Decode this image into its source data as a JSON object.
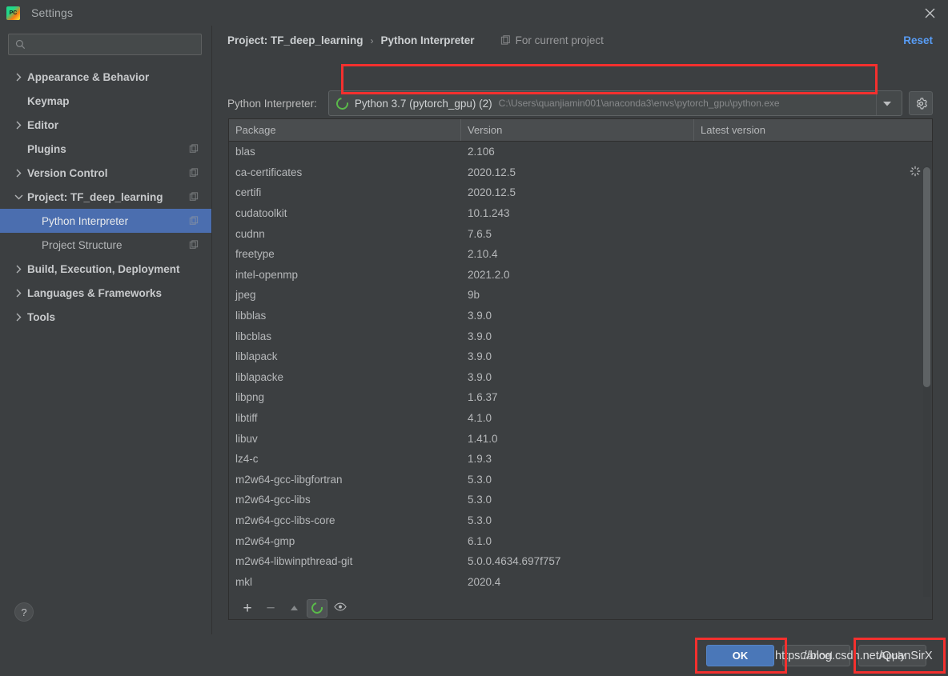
{
  "window": {
    "title": "Settings",
    "app_icon": "pycharm-icon",
    "close_icon": "close-icon"
  },
  "sidebar": {
    "search": {
      "value": "",
      "placeholder": "",
      "icon": "search-icon"
    },
    "help_label": "?",
    "items": [
      {
        "label": "Appearance & Behavior",
        "level": 0,
        "arrow": "chevron-right",
        "badge": false,
        "selected": false
      },
      {
        "label": "Keymap",
        "level": 0,
        "arrow": "none",
        "badge": false,
        "selected": false
      },
      {
        "label": "Editor",
        "level": 0,
        "arrow": "chevron-right",
        "badge": false,
        "selected": false
      },
      {
        "label": "Plugins",
        "level": 0,
        "arrow": "none",
        "badge": true,
        "selected": false
      },
      {
        "label": "Version Control",
        "level": 0,
        "arrow": "chevron-right",
        "badge": true,
        "selected": false
      },
      {
        "label": "Project: TF_deep_learning",
        "level": 0,
        "arrow": "chevron-down",
        "badge": true,
        "selected": false
      },
      {
        "label": "Python Interpreter",
        "level": 1,
        "arrow": "none",
        "badge": true,
        "selected": true
      },
      {
        "label": "Project Structure",
        "level": 1,
        "arrow": "none",
        "badge": true,
        "selected": false
      },
      {
        "label": "Build, Execution, Deployment",
        "level": 0,
        "arrow": "chevron-right",
        "badge": false,
        "selected": false
      },
      {
        "label": "Languages & Frameworks",
        "level": 0,
        "arrow": "chevron-right",
        "badge": false,
        "selected": false
      },
      {
        "label": "Tools",
        "level": 0,
        "arrow": "chevron-right",
        "badge": false,
        "selected": false
      }
    ]
  },
  "main": {
    "breadcrumb": {
      "project": "Project: TF_deep_learning",
      "separator": "›",
      "page": "Python Interpreter"
    },
    "scope_tag": {
      "label": "For current project",
      "icon": "project-scope-icon"
    },
    "reset_label": "Reset",
    "interpreter": {
      "field_label": "Python Interpreter:",
      "name": "Python 3.7 (pytorch_gpu) (2)",
      "path": "C:\\Users\\quanjiamin001\\anaconda3\\envs\\pytorch_gpu\\python.exe",
      "env_icon": "conda-env-icon",
      "dropdown_icon": "chevron-down-icon",
      "settings_icon": "gear-icon",
      "highlight_color": "#f4302e"
    },
    "packages": {
      "columns": [
        "Package",
        "Version",
        "Latest version"
      ],
      "loading_icon": "loading-spinner-icon",
      "rows": [
        {
          "package": "blas",
          "version": "2.106",
          "latest": ""
        },
        {
          "package": "ca-certificates",
          "version": "2020.12.5",
          "latest": ""
        },
        {
          "package": "certifi",
          "version": "2020.12.5",
          "latest": ""
        },
        {
          "package": "cudatoolkit",
          "version": "10.1.243",
          "latest": ""
        },
        {
          "package": "cudnn",
          "version": "7.6.5",
          "latest": ""
        },
        {
          "package": "freetype",
          "version": "2.10.4",
          "latest": ""
        },
        {
          "package": "intel-openmp",
          "version": "2021.2.0",
          "latest": ""
        },
        {
          "package": "jpeg",
          "version": "9b",
          "latest": ""
        },
        {
          "package": "libblas",
          "version": "3.9.0",
          "latest": ""
        },
        {
          "package": "libcblas",
          "version": "3.9.0",
          "latest": ""
        },
        {
          "package": "liblapack",
          "version": "3.9.0",
          "latest": ""
        },
        {
          "package": "liblapacke",
          "version": "3.9.0",
          "latest": ""
        },
        {
          "package": "libpng",
          "version": "1.6.37",
          "latest": ""
        },
        {
          "package": "libtiff",
          "version": "4.1.0",
          "latest": ""
        },
        {
          "package": "libuv",
          "version": "1.41.0",
          "latest": ""
        },
        {
          "package": "lz4-c",
          "version": "1.9.3",
          "latest": ""
        },
        {
          "package": "m2w64-gcc-libgfortran",
          "version": "5.3.0",
          "latest": ""
        },
        {
          "package": "m2w64-gcc-libs",
          "version": "5.3.0",
          "latest": ""
        },
        {
          "package": "m2w64-gcc-libs-core",
          "version": "5.3.0",
          "latest": ""
        },
        {
          "package": "m2w64-gmp",
          "version": "6.1.0",
          "latest": ""
        },
        {
          "package": "m2w64-libwinpthread-git",
          "version": "5.0.0.4634.697f757",
          "latest": ""
        },
        {
          "package": "mkl",
          "version": "2020.4",
          "latest": ""
        }
      ],
      "toolbar": [
        {
          "name": "add-package-button",
          "glyph": "+",
          "active": false
        },
        {
          "name": "remove-package-button",
          "glyph": "−",
          "active": false
        },
        {
          "name": "upgrade-package-button",
          "glyph": "▲",
          "active": false
        },
        {
          "name": "conda-env-button",
          "glyph": "conda-ring-icon",
          "active": true
        },
        {
          "name": "show-early-releases-button",
          "glyph": "eye-icon",
          "active": false
        }
      ]
    }
  },
  "footer": {
    "ok_label": "OK",
    "cancel_label": "Cancel",
    "apply_label": "Apply",
    "watermark": "https://blog.csdn.net/QuanSirX"
  }
}
